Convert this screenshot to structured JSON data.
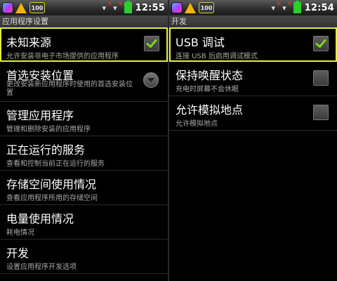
{
  "left": {
    "status": {
      "badge": "100",
      "clock": "12:55"
    },
    "header": "应用程序设置",
    "items": [
      {
        "title": "未知来源",
        "summary": "允许安装非电子市场提供的应用程序",
        "checked": true
      },
      {
        "title": "首选安装位置",
        "summary": "更改安装新应用程序时使用的首选安装位置"
      },
      {
        "title": "管理应用程序",
        "summary": "管理和删除安装的应用程序"
      },
      {
        "title": "正在运行的服务",
        "summary": "查看和控制当前正在运行的服务"
      },
      {
        "title": "存储空间使用情况",
        "summary": "查看应用程序所用的存储空间"
      },
      {
        "title": "电量使用情况",
        "summary": "耗电情况"
      },
      {
        "title": "开发",
        "summary": "设置应用程序开发选项"
      }
    ]
  },
  "right": {
    "status": {
      "badge": "100",
      "clock": "12:54"
    },
    "header": "开发",
    "items": [
      {
        "title": "USB 调试",
        "summary": "连接 USB 后启用调试模式",
        "checked": true
      },
      {
        "title": "保持唤醒状态",
        "summary": "充电时屏幕不会休眠",
        "checked": false
      },
      {
        "title": "允许模拟地点",
        "summary": "允许模拟地点",
        "checked": false
      }
    ]
  },
  "colors": {
    "highlight": "#e6ee3a",
    "check": "#7fd321",
    "battery": "#2ecc2e"
  }
}
